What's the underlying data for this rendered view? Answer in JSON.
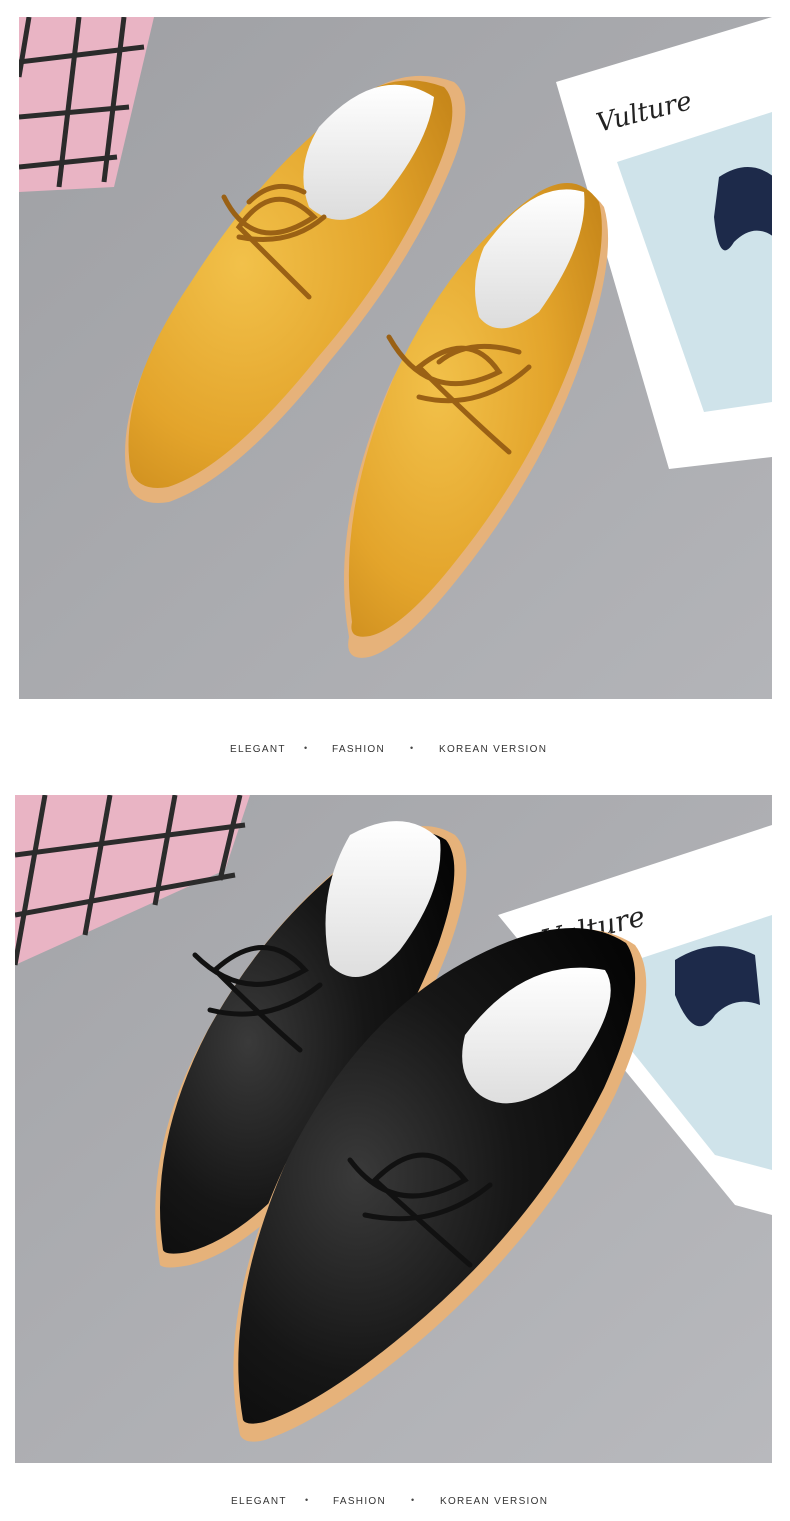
{
  "sections": [
    {
      "photo": {
        "subject": "yellow lace-up leather loafers",
        "shoe_color": "#e3a42b"
      },
      "caption": {
        "items": [
          "ELEGANT",
          "FASHION",
          "KOREAN VERSION"
        ],
        "separator": "•"
      }
    },
    {
      "photo": {
        "subject": "black lace-up leather loafers",
        "shoe_color": "#141414"
      },
      "caption": {
        "items": [
          "ELEGANT",
          "FASHION",
          "KOREAN VERSION"
        ],
        "separator": "•"
      }
    }
  ],
  "magazine_title": "Vulture",
  "colors": {
    "background": "#ffffff",
    "floor": "#a6a7ab",
    "pink_pad": "#e9b4c4",
    "sole": "#e6b27a",
    "page_blue": "#cfe3ea",
    "caption_text": "#333333"
  }
}
